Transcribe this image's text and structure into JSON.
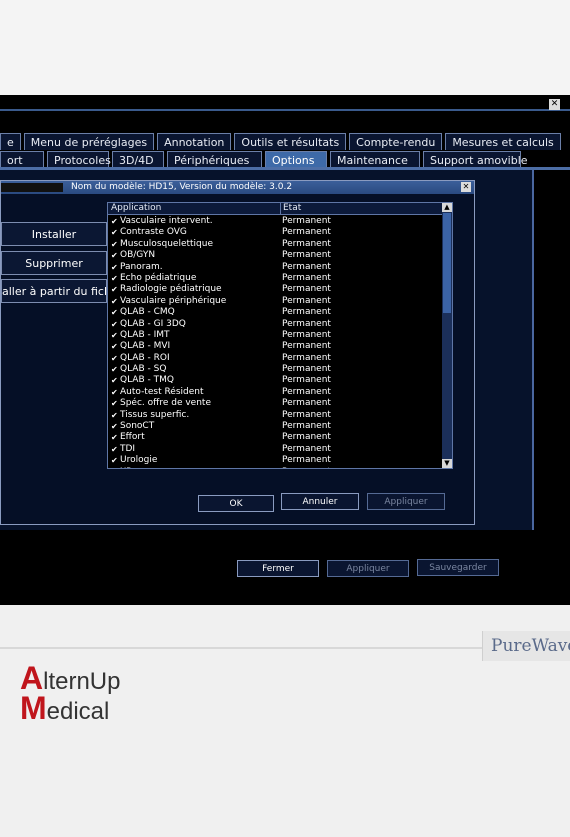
{
  "window": {
    "close_glyph": "✕"
  },
  "tabs_row1": [
    "e",
    "Menu de préréglages",
    "Annotation",
    "Outils et résultats",
    "Compte-rendu",
    "Mesures et calculs"
  ],
  "tabs_row2": [
    "ort",
    "Protocoles",
    "3D/4D",
    "Périphériques",
    "Options",
    "Maintenance",
    "Support amovible"
  ],
  "active_tab": "Options",
  "side_buttons": {
    "install": "Installer",
    "delete": "Supprimer",
    "install_file": "aller à partir du fichier"
  },
  "dialog": {
    "title": "Nom du modèle: HD15, Version du modèle: 3.0.2",
    "close_glyph": "✕",
    "col_app": "Application",
    "col_state": "Etat",
    "check_glyph": "✔",
    "rows": [
      {
        "app": "Vasculaire intervent.",
        "state": "Permanent"
      },
      {
        "app": "Contraste OVG",
        "state": "Permanent"
      },
      {
        "app": "Musculosquelettique",
        "state": "Permanent"
      },
      {
        "app": "OB/GYN",
        "state": "Permanent"
      },
      {
        "app": "Panoram.",
        "state": "Permanent"
      },
      {
        "app": "Echo pédiatrique",
        "state": "Permanent"
      },
      {
        "app": "Radiologie pédiatrique",
        "state": "Permanent"
      },
      {
        "app": "Vasculaire périphérique",
        "state": "Permanent"
      },
      {
        "app": "QLAB - CMQ",
        "state": "Permanent"
      },
      {
        "app": "QLAB - GI 3DQ",
        "state": "Permanent"
      },
      {
        "app": "QLAB - IMT",
        "state": "Permanent"
      },
      {
        "app": "QLAB - MVI",
        "state": "Permanent"
      },
      {
        "app": "QLAB - ROI",
        "state": "Permanent"
      },
      {
        "app": "QLAB - SQ",
        "state": "Permanent"
      },
      {
        "app": "QLAB - TMQ",
        "state": "Permanent"
      },
      {
        "app": "Auto-test Résident",
        "state": "Permanent"
      },
      {
        "app": "Spéc. offre de vente",
        "state": "Permanent"
      },
      {
        "app": "Tissus superfic.",
        "state": "Permanent"
      },
      {
        "app": "SonoCT",
        "state": "Permanent"
      },
      {
        "app": "Effort",
        "state": "Permanent"
      },
      {
        "app": "TDI",
        "state": "Permanent"
      },
      {
        "app": "Urologie",
        "state": "Permanent"
      },
      {
        "app": "XRes",
        "state": "Permanent"
      }
    ],
    "ok": "OK",
    "cancel": "Annuler",
    "apply": "Appliquer"
  },
  "footer_buttons": {
    "close": "Fermer",
    "apply": "Appliquer",
    "save": "Sauvegarder"
  },
  "brand": {
    "purewave": "PureWave",
    "alternup_a": "A",
    "alternup_rest": "ltern",
    "alternup_up": "Up",
    "medical_m": "M",
    "medical_rest": "edical"
  },
  "colors": {
    "screen_bg": "#000000",
    "panel_bg": "#06122b",
    "active_tab": "#3e6aa8",
    "brand_red": "#c0151c"
  }
}
